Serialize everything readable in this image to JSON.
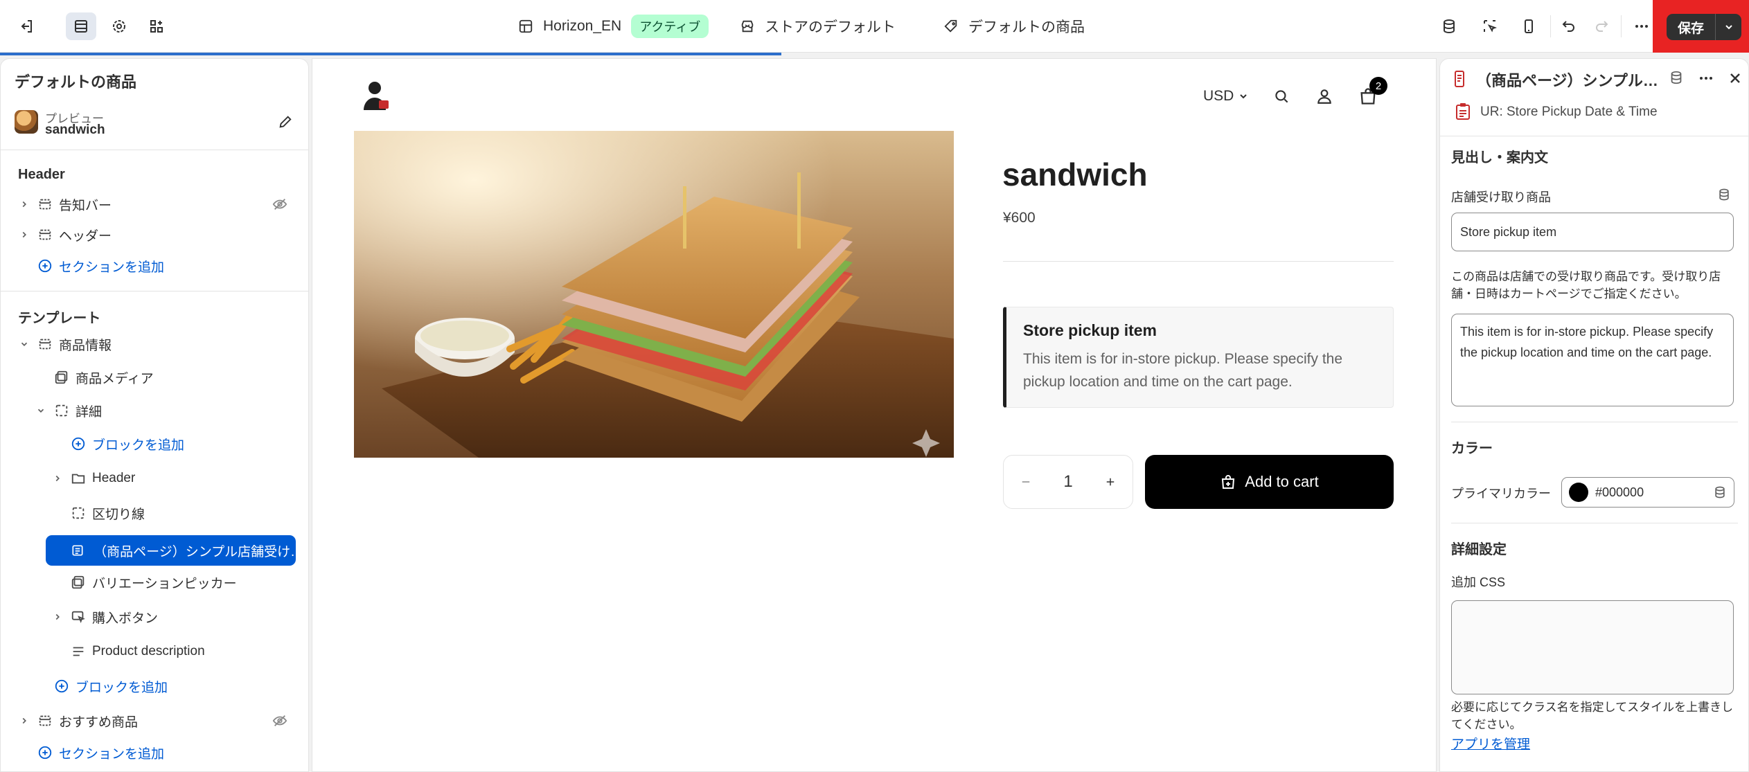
{
  "topbar": {
    "theme_name": "Horizon_EN",
    "theme_status": "アクティブ",
    "store_default": "ストアのデフォルト",
    "default_product": "デフォルトの商品",
    "save_label": "保存"
  },
  "left_panel": {
    "title": "デフォルトの商品",
    "preview_label": "プレビュー",
    "preview_value": "sandwich",
    "header_heading": "Header",
    "header_items": [
      {
        "label": "告知バー"
      },
      {
        "label": "ヘッダー"
      }
    ],
    "add_section": "セクションを追加",
    "template_heading": "テンプレート",
    "product_info": "商品情報",
    "product_media": "商品メディア",
    "details": "詳細",
    "add_block": "ブロックを追加",
    "detail_header": "Header",
    "divider": "区切り線",
    "selected_block": "（商品ページ）シンプル店舗受け…",
    "variant_picker": "バリエーションピッカー",
    "buy_button": "購入ボタン",
    "product_description": "Product description",
    "add_block_2": "ブロックを追加",
    "recommended": "おすすめ商品",
    "add_section_2": "セクションを追加"
  },
  "store": {
    "currency": "USD",
    "cart_count": "2",
    "product_title": "sandwich",
    "price": "¥600",
    "pickup_title": "Store pickup item",
    "pickup_desc": "This item is for in-store pickup. Please specify the pickup location and time on the cart page.",
    "quantity": "1",
    "add_to_cart": "Add to cart"
  },
  "right_panel": {
    "title": "（商品ページ）シンプル…",
    "app_name": "UR: Store Pickup Date & Time",
    "section_heading": "見出し・案内文",
    "pickup_label": "店舗受け取り商品",
    "pickup_value": "Store pickup item",
    "desc_help": "この商品は店舗での受け取り商品です。受け取り店舗・日時はカートページでご指定ください。",
    "desc_value": "This item is for in-store pickup. Please specify the pickup location and time on the cart page.",
    "color_heading": "カラー",
    "primary_color_label": "プライマリカラー",
    "primary_color_value": "#000000",
    "advanced_heading": "詳細設定",
    "css_label": "追加 CSS",
    "css_value": "",
    "css_help": "必要に応じてクラス名を指定してスタイルを上書きしてください。",
    "manage_app": "アプリを管理"
  },
  "colors": {
    "accent": "#005bd3",
    "save_highlight": "#e82323",
    "badge_bg": "#b4fed2"
  }
}
